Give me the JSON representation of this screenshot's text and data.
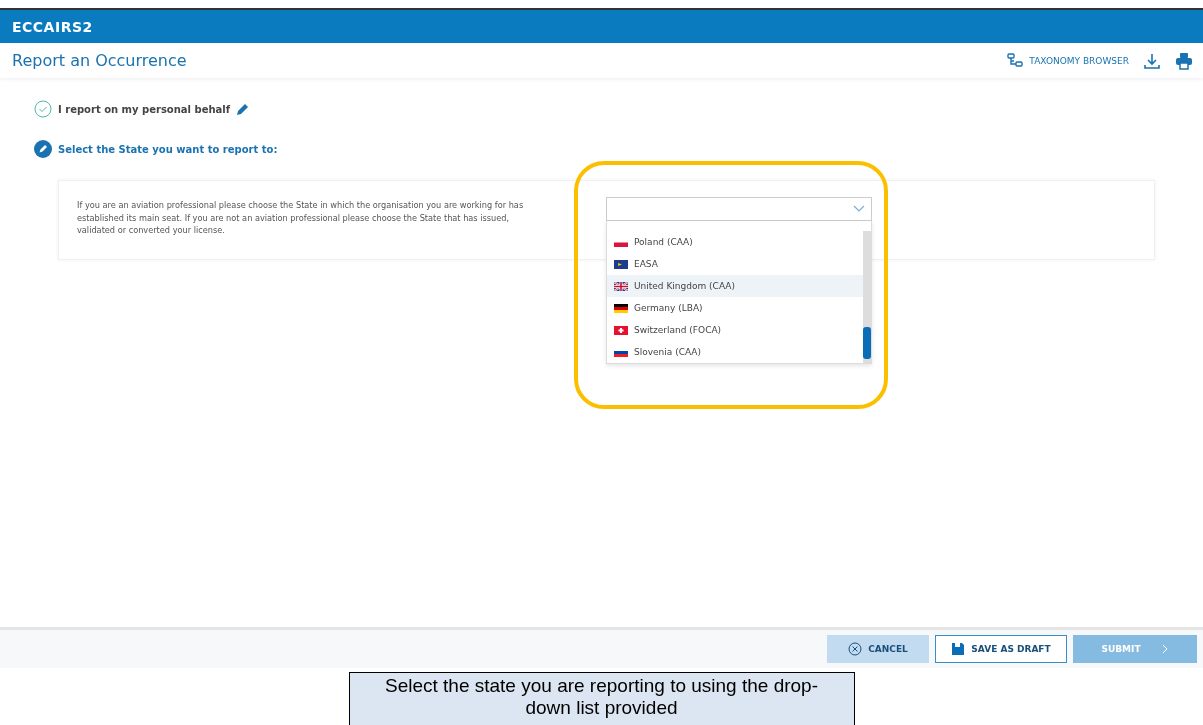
{
  "app": {
    "logo": "ECCAIRS2"
  },
  "page": {
    "title": "Report an Occurrence",
    "actions": [
      {
        "kind": "taxonomy",
        "label": "TAXONOMY BROWSER"
      },
      {
        "kind": "download"
      },
      {
        "kind": "print"
      }
    ]
  },
  "steps": [
    {
      "label": "I report on my personal behalf",
      "completed": true
    },
    {
      "label": "Select the State you want to report to:",
      "completed": false
    }
  ],
  "state_panel": {
    "instructions": "If you are an aviation professional please choose the State in which the organisation you are working for has established its main seat. If you are not an aviation professional please choose the State that has issued, validated or converted your license.",
    "dropdown": {
      "expanded": true,
      "options": [
        {
          "label": "Poland (CAA)",
          "kind": "poland",
          "selected": false
        },
        {
          "label": "EASA",
          "kind": "easa",
          "selected": false
        },
        {
          "label": "United Kingdom (CAA)",
          "kind": "uk",
          "selected": true
        },
        {
          "label": "Germany (LBA)",
          "kind": "germany",
          "selected": false
        },
        {
          "label": "Switzerland (FOCA)",
          "kind": "switzerland",
          "selected": false
        },
        {
          "label": "Slovenia (CAA)",
          "kind": "slovenia",
          "selected": false
        }
      ]
    }
  },
  "footer": {
    "buttons": [
      {
        "kind": "cancel",
        "label": "CANCEL",
        "disabled": false
      },
      {
        "kind": "draft",
        "label": "SAVE AS DRAFT",
        "disabled": false
      },
      {
        "kind": "submit",
        "label": "SUBMIT",
        "disabled": true
      }
    ]
  },
  "caption": "Select the state you are reporting to using the drop-down list provided"
}
